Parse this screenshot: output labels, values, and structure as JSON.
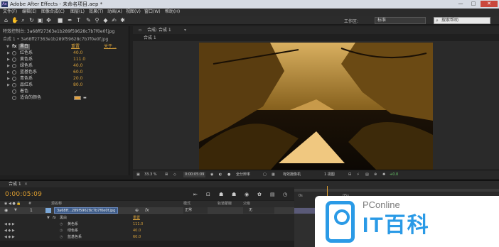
{
  "window": {
    "title": "Adobe After Effects - 未命名项目.aep *",
    "buttons": [
      "—",
      "□",
      "✕"
    ]
  },
  "menu": [
    "文件(F)",
    "编辑(E)",
    "图像合成(C)",
    "图层(L)",
    "效果(T)",
    "动画(A)",
    "视图(V)",
    "窗口(W)",
    "帮助(H)"
  ],
  "toolbar": {
    "icons": [
      "home-icon",
      "hand-icon",
      "zoom-icon",
      "rotate-icon",
      "camera-icon",
      "pan-behind-icon",
      "rectangle-mask-icon",
      "pen-icon",
      "text-icon",
      "brush-icon",
      "clone-stamp-icon",
      "eraser-icon",
      "roto-brush-icon",
      "puppet-icon"
    ],
    "workspace_label": "工作区:",
    "workspace_value": "标准",
    "help_placeholder": "搜索帮助"
  },
  "effect_controls": {
    "tab": "特效控制台: 3a68ff27363e1b289f59628c7b7f0e0f.jpg",
    "subtitle": "合成 1 • 3a68ff27363e1b289f59628c7b7f0e0f.jpg",
    "header": "黑白",
    "reset": "重置",
    "about": "关于...",
    "rows": [
      {
        "label": "红色系",
        "value": "40.0"
      },
      {
        "label": "黄色系",
        "value": "111.0"
      },
      {
        "label": "绿色系",
        "value": "40.0"
      },
      {
        "label": "蓝基色系",
        "value": "60.0"
      },
      {
        "label": "青色系",
        "value": "20.0"
      },
      {
        "label": "品红系",
        "value": "80.0"
      }
    ],
    "tint_label": "着色",
    "tint_color_label": "适合的颜色",
    "tint_color": "#e3a23f"
  },
  "composition": {
    "tab": "合成: 合成 1",
    "subtab": "合成 1",
    "viewer_bar": {
      "zoom": "33.3 %",
      "timecode": "0:00:05:09",
      "resolution": "全分辨率",
      "camera": "有效摄像机",
      "views": "1 视图",
      "exposure": "+0.0"
    }
  },
  "timeline": {
    "tab": "合成 1",
    "timecode": "0:00:05:09",
    "columns": {
      "source": "源名称",
      "mode": "模式",
      "trkmat": "轨道蒙版",
      "parent": "父级"
    },
    "layer": {
      "number": "1",
      "name": "3a68ff...289f59628c7b7f0e0f.jpg",
      "mode": "正常",
      "parent": "无"
    },
    "sub_rows": [
      {
        "label": "黑白",
        "value": "重置"
      },
      {
        "label": "黄色系",
        "value": "111.0"
      },
      {
        "label": "绿色系",
        "value": "40.0"
      },
      {
        "label": "蓝基色系",
        "value": "60.0"
      }
    ],
    "ruler": [
      "0s",
      "05s"
    ]
  },
  "watermark": {
    "brand_top": "PConline",
    "brand_big": "IT百科"
  }
}
